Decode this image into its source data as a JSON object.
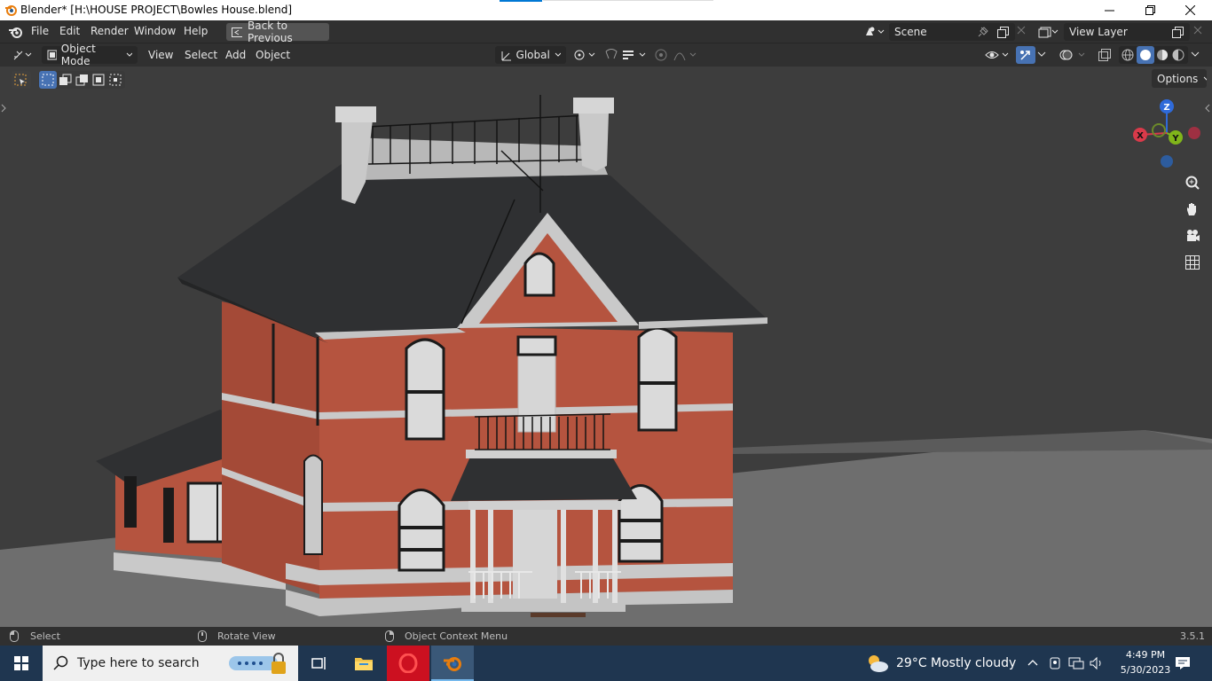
{
  "window": {
    "title": "Blender* [H:\\HOUSE PROJECT\\Bowles House.blend]"
  },
  "menu": {
    "file": "File",
    "edit": "Edit",
    "render": "Render",
    "window": "Window",
    "help": "Help",
    "back": "Back to Previous"
  },
  "scene": {
    "label": "Scene",
    "view_layer": "View Layer"
  },
  "header": {
    "mode": "Object Mode",
    "view": "View",
    "select": "Select",
    "add": "Add",
    "object": "Object",
    "orientation": "Global",
    "options": "Options"
  },
  "gizmo": {
    "x": "X",
    "y": "Y",
    "z": "Z"
  },
  "status": {
    "select": "Select",
    "rotate": "Rotate View",
    "context": "Object Context Menu",
    "version": "3.5.1"
  },
  "taskbar": {
    "search_placeholder": "Type here to search",
    "temp": "29°C",
    "weather": "Mostly cloudy",
    "time": "4:49 PM",
    "date": "5/30/2023"
  },
  "colors": {
    "accent": "#4772b3",
    "brick": "#b5543f",
    "roof": "#2f3032",
    "trim": "#bdbdbd",
    "floor": "#6e6e6e"
  }
}
